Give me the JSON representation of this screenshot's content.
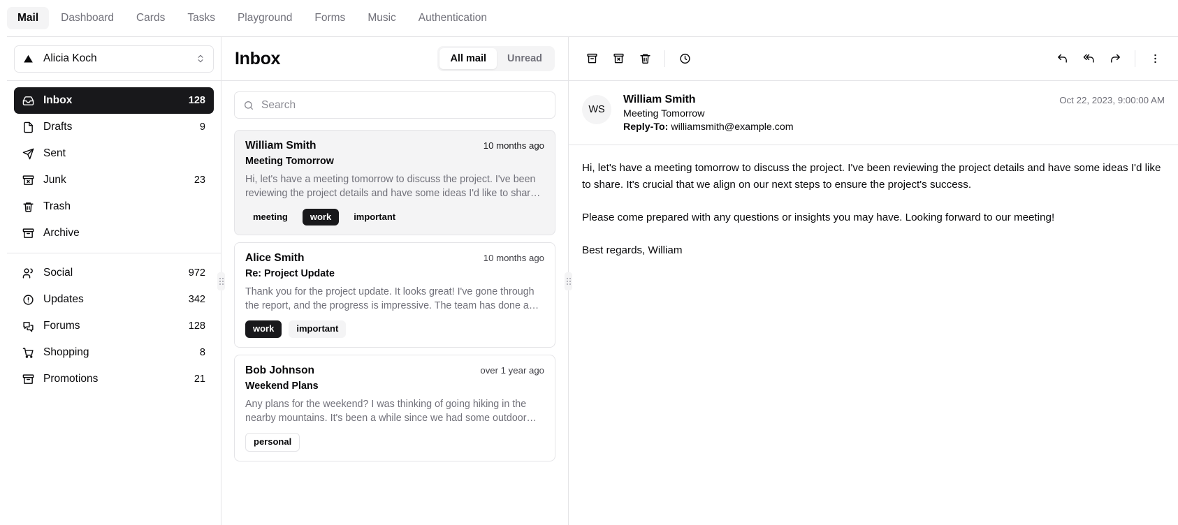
{
  "nav": {
    "tabs": [
      {
        "label": "Mail",
        "active": true
      },
      {
        "label": "Dashboard",
        "active": false
      },
      {
        "label": "Cards",
        "active": false
      },
      {
        "label": "Tasks",
        "active": false
      },
      {
        "label": "Playground",
        "active": false
      },
      {
        "label": "Forms",
        "active": false
      },
      {
        "label": "Music",
        "active": false
      },
      {
        "label": "Authentication",
        "active": false
      }
    ]
  },
  "sidebar": {
    "account": {
      "name": "Alicia Koch",
      "icon": "triangle-logo-icon",
      "chevron": "chevron-up-down-icon"
    },
    "groups": [
      {
        "items": [
          {
            "label": "Inbox",
            "count": "128",
            "icon": "inbox-icon",
            "active": true
          },
          {
            "label": "Drafts",
            "count": "9",
            "icon": "file-icon",
            "active": false
          },
          {
            "label": "Sent",
            "count": "",
            "icon": "send-icon",
            "active": false
          },
          {
            "label": "Junk",
            "count": "23",
            "icon": "archive-x-icon",
            "active": false
          },
          {
            "label": "Trash",
            "count": "",
            "icon": "trash-icon",
            "active": false
          },
          {
            "label": "Archive",
            "count": "",
            "icon": "archive-icon",
            "active": false
          }
        ]
      },
      {
        "items": [
          {
            "label": "Social",
            "count": "972",
            "icon": "users-icon",
            "active": false
          },
          {
            "label": "Updates",
            "count": "342",
            "icon": "alert-circle-icon",
            "active": false
          },
          {
            "label": "Forums",
            "count": "128",
            "icon": "messages-icon",
            "active": false
          },
          {
            "label": "Shopping",
            "count": "8",
            "icon": "shopping-cart-icon",
            "active": false
          },
          {
            "label": "Promotions",
            "count": "21",
            "icon": "archive-icon",
            "active": false
          }
        ]
      }
    ]
  },
  "maillist": {
    "title": "Inbox",
    "filters": [
      {
        "label": "All mail",
        "active": true
      },
      {
        "label": "Unread",
        "active": false
      }
    ],
    "search": {
      "placeholder": "Search",
      "value": "",
      "icon": "search-icon"
    },
    "items": [
      {
        "sender": "William Smith",
        "time": "10 months ago",
        "subject": "Meeting Tomorrow",
        "snippet": "Hi, let's have a meeting tomorrow to discuss the project. I've been reviewing the project details and have some ideas I'd like to shar…",
        "selected": true,
        "tags": [
          {
            "label": "meeting",
            "style": "soft"
          },
          {
            "label": "work",
            "style": "solid"
          },
          {
            "label": "important",
            "style": "soft"
          }
        ]
      },
      {
        "sender": "Alice Smith",
        "time": "10 months ago",
        "subject": "Re: Project Update",
        "snippet": "Thank you for the project update. It looks great! I've gone through the report, and the progress is impressive. The team has done a…",
        "selected": false,
        "tags": [
          {
            "label": "work",
            "style": "solid"
          },
          {
            "label": "important",
            "style": "soft"
          }
        ]
      },
      {
        "sender": "Bob Johnson",
        "time": "over 1 year ago",
        "subject": "Weekend Plans",
        "snippet": "Any plans for the weekend? I was thinking of going hiking in the nearby mountains. It's been a while since we had some outdoor…",
        "selected": false,
        "tags": [
          {
            "label": "personal",
            "style": "outline"
          }
        ]
      }
    ]
  },
  "reader": {
    "toolbar": {
      "archive": "archive-icon",
      "junk": "archive-x-icon",
      "trash": "trash-icon",
      "snooze": "clock-icon",
      "reply": "reply-icon",
      "reply_all": "reply-all-icon",
      "forward": "forward-icon",
      "more": "more-vertical-icon"
    },
    "avatar_initials": "WS",
    "sender": "William Smith",
    "subject": "Meeting Tomorrow",
    "reply_to_label": "Reply-To:",
    "reply_to_email": "williamsmith@example.com",
    "date": "Oct 22, 2023, 9:00:00 AM",
    "body": "Hi, let's have a meeting tomorrow to discuss the project. I've been reviewing the project details and have some ideas I'd like to share. It's crucial that we align on our next steps to ensure the project's success.\n\nPlease come prepared with any questions or insights you may have. Looking forward to our meeting!\n\nBest regards, William"
  },
  "colors": {
    "accent": "#18181b",
    "muted_bg": "#f4f4f5",
    "border": "#e4e4e7",
    "muted_text": "#71717a"
  }
}
